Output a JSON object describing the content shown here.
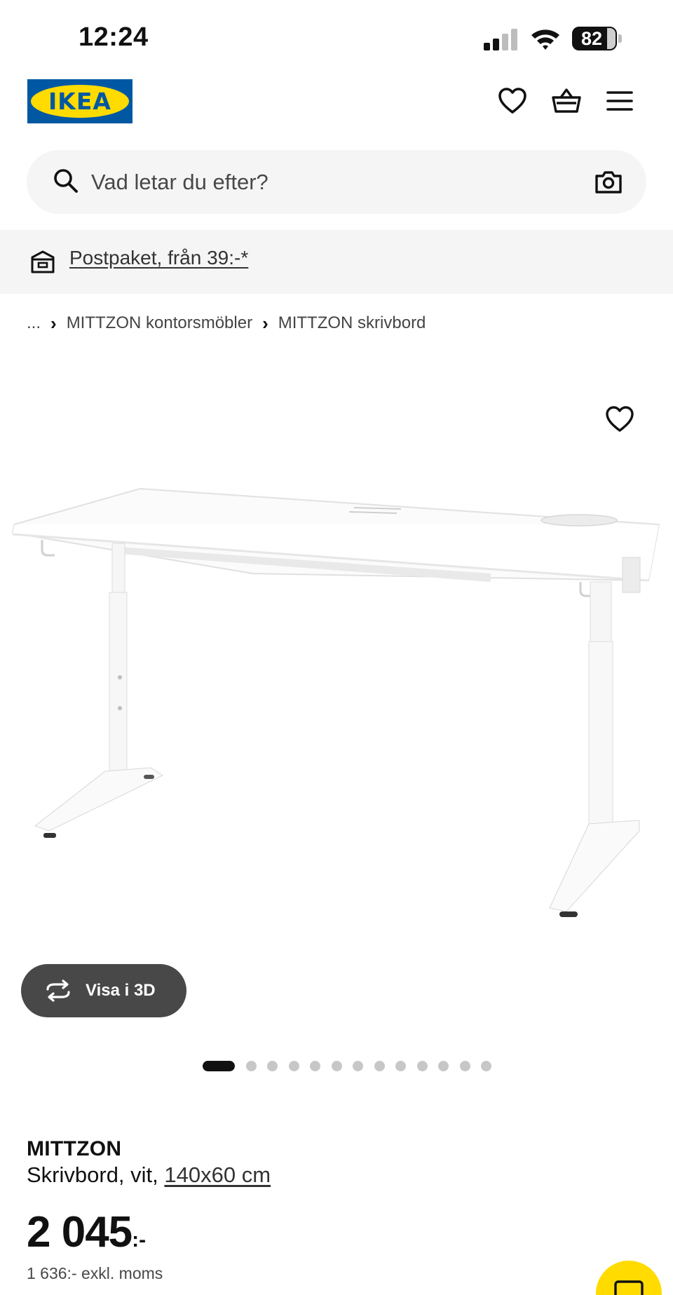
{
  "status_bar": {
    "time": "12:24",
    "battery": "82",
    "icons": [
      "cellular-signal-icon",
      "wifi-icon",
      "battery-icon"
    ]
  },
  "header": {
    "logo_text": "IKEA",
    "icons": [
      "heart-icon",
      "shopping-basket-icon",
      "hamburger-menu-icon"
    ],
    "colors": {
      "logo_blue": "#0058a3",
      "logo_yellow": "#ffdb00"
    }
  },
  "search": {
    "placeholder": "Vad letar du efter?",
    "icons": [
      "search-icon",
      "camera-icon"
    ]
  },
  "banner": {
    "link": "Postpaket, från 39:-*",
    "icon": "delivery-package-icon"
  },
  "breadcrumb": {
    "ellipsis": "...",
    "items": [
      "MITTZON kontorsmöbler",
      "MITTZON skrivbord"
    ]
  },
  "gallery": {
    "view_3d_label": "Visa i 3D",
    "total_images": 13,
    "active_index": 0
  },
  "product": {
    "name": "MITTZON",
    "description": "Skrivbord, vit, ",
    "size_link": "140x60 cm",
    "price": "2 045",
    "price_suffix": ":-",
    "price_exkl": "1 636:- exkl. moms"
  },
  "colors": {
    "accent_yellow": "#ffdb00",
    "button_dark": "#484848",
    "surface_grey": "#f5f5f5"
  }
}
